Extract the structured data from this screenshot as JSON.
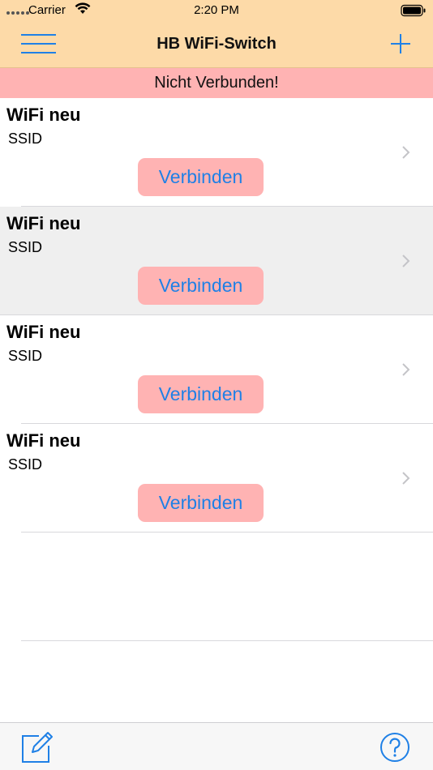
{
  "status_bar": {
    "carrier": "Carrier",
    "time": "2:20 PM"
  },
  "nav": {
    "title": "HB WiFi-Switch",
    "menu_icon": "hamburger-menu-icon",
    "add_icon": "plus-icon"
  },
  "banner": {
    "text": "Nicht Verbunden!"
  },
  "devices": [
    {
      "name": "WiFi neu",
      "ssid": "SSID",
      "button": "Verbinden"
    },
    {
      "name": "WiFi neu",
      "ssid": "SSID",
      "button": "Verbinden"
    },
    {
      "name": "WiFi neu",
      "ssid": "SSID",
      "button": "Verbinden"
    },
    {
      "name": "WiFi neu",
      "ssid": "SSID",
      "button": "Verbinden"
    }
  ],
  "toolbar": {
    "edit_icon": "edit-icon",
    "help_icon": "help-icon"
  },
  "colors": {
    "header_bg": "#fddaa8",
    "banner_bg": "#ffb3b3",
    "button_bg": "#ffb3b3",
    "accent": "#1f80e6",
    "selected_row": "#efefef"
  }
}
